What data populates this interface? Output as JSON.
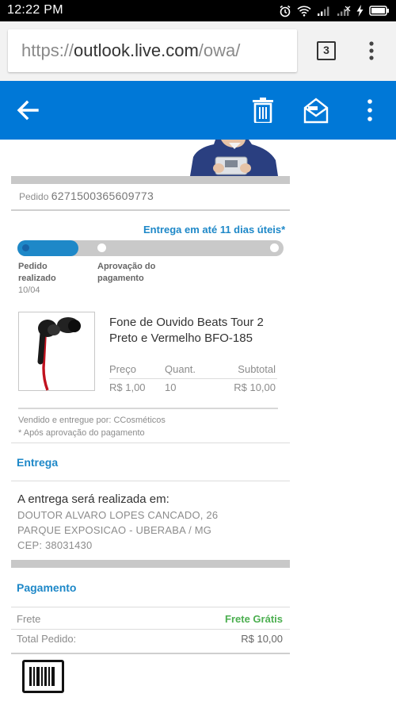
{
  "status_bar": {
    "time": "12:22 PM"
  },
  "browser": {
    "url_prefix": "https://",
    "url_host": "outlook.live.com",
    "url_path": "/owa/",
    "tab_count": "3"
  },
  "toolbar": {
    "icons": [
      "back-arrow-icon",
      "trash-icon",
      "mark-read-icon",
      "more-vert-icon"
    ],
    "accent": "#0078d7"
  },
  "order": {
    "label": "Pedido",
    "number": "6271500365609773",
    "delivery_estimate": "Entrega em até 11 dias úteis*",
    "progress_fraction": 0.23,
    "steps": [
      {
        "label": "Pedido realizado",
        "date": "10/04"
      },
      {
        "label": "Aprovação do pagamento",
        "date": ""
      }
    ]
  },
  "product": {
    "name": "Fone de Ouvido Beats Tour 2 Preto e Vermelho BFO-185",
    "columns": [
      "Preço",
      "Quant.",
      "Subtotal"
    ],
    "price": "R$ 1,00",
    "quantity": "10",
    "subtotal": "R$ 10,00",
    "seller_note": "Vendido e entregue por: CCosméticos",
    "approval_note": "* Após aprovação do pagamento"
  },
  "delivery": {
    "title": "Entrega",
    "heading": "A entrega será realizada em:",
    "address_lines": [
      "DOUTOR ALVARO LOPES CANCADO, 26",
      "PARQUE EXPOSICAO - UBERABA / MG",
      "CEP: 38031430"
    ]
  },
  "payment": {
    "title": "Pagamento",
    "shipping_label": "Frete",
    "shipping_value": "Frete Grátis",
    "total_label": "Total Pedido:",
    "total_value": "R$ 10,00"
  },
  "colors": {
    "link_blue": "#1e88c8",
    "free_green": "#4caf50"
  }
}
